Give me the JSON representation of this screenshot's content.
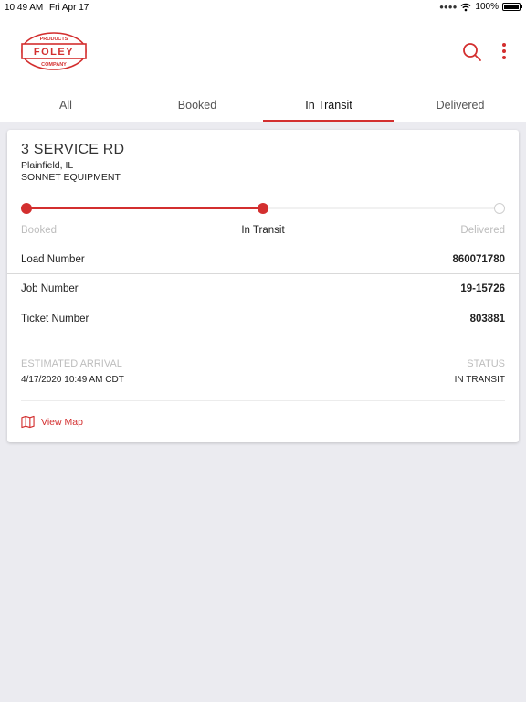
{
  "status_bar": {
    "time": "10:49 AM",
    "date": "Fri Apr 17",
    "battery": "100%",
    "icons": [
      "dots-icon",
      "wifi-icon",
      "battery-icon"
    ]
  },
  "header": {
    "logo": {
      "top_text": "PRODUCTS",
      "main_text": "FOLEY",
      "bottom_text": "COMPANY"
    },
    "actions": [
      "search-icon",
      "more-vertical-icon"
    ]
  },
  "tabs": [
    {
      "label": "All"
    },
    {
      "label": "Booked"
    },
    {
      "label": "In Transit",
      "active": true
    },
    {
      "label": "Delivered"
    }
  ],
  "load": {
    "address": "3 SERVICE RD",
    "city": "Plainfield, IL",
    "company": "SONNET EQUIPMENT",
    "progress": {
      "steps": [
        "Booked",
        "In Transit",
        "Delivered"
      ],
      "current_index": 1,
      "fraction": 0.5
    },
    "details": [
      {
        "label": "Load Number",
        "value": "860071780"
      },
      {
        "label": "Job Number",
        "value": "19-15726"
      },
      {
        "label": "Ticket Number",
        "value": "803881"
      }
    ],
    "eta": {
      "label": "ESTIMATED ARRIVAL",
      "value": "4/17/2020 10:49 AM CDT"
    },
    "status": {
      "label": "STATUS",
      "value": "IN TRANSIT"
    },
    "view_map": {
      "label": "View Map",
      "icon": "map-icon"
    }
  },
  "colors": {
    "accent": "#d32f2f",
    "background": "#ebebf0",
    "muted": "#bdbdbd"
  }
}
